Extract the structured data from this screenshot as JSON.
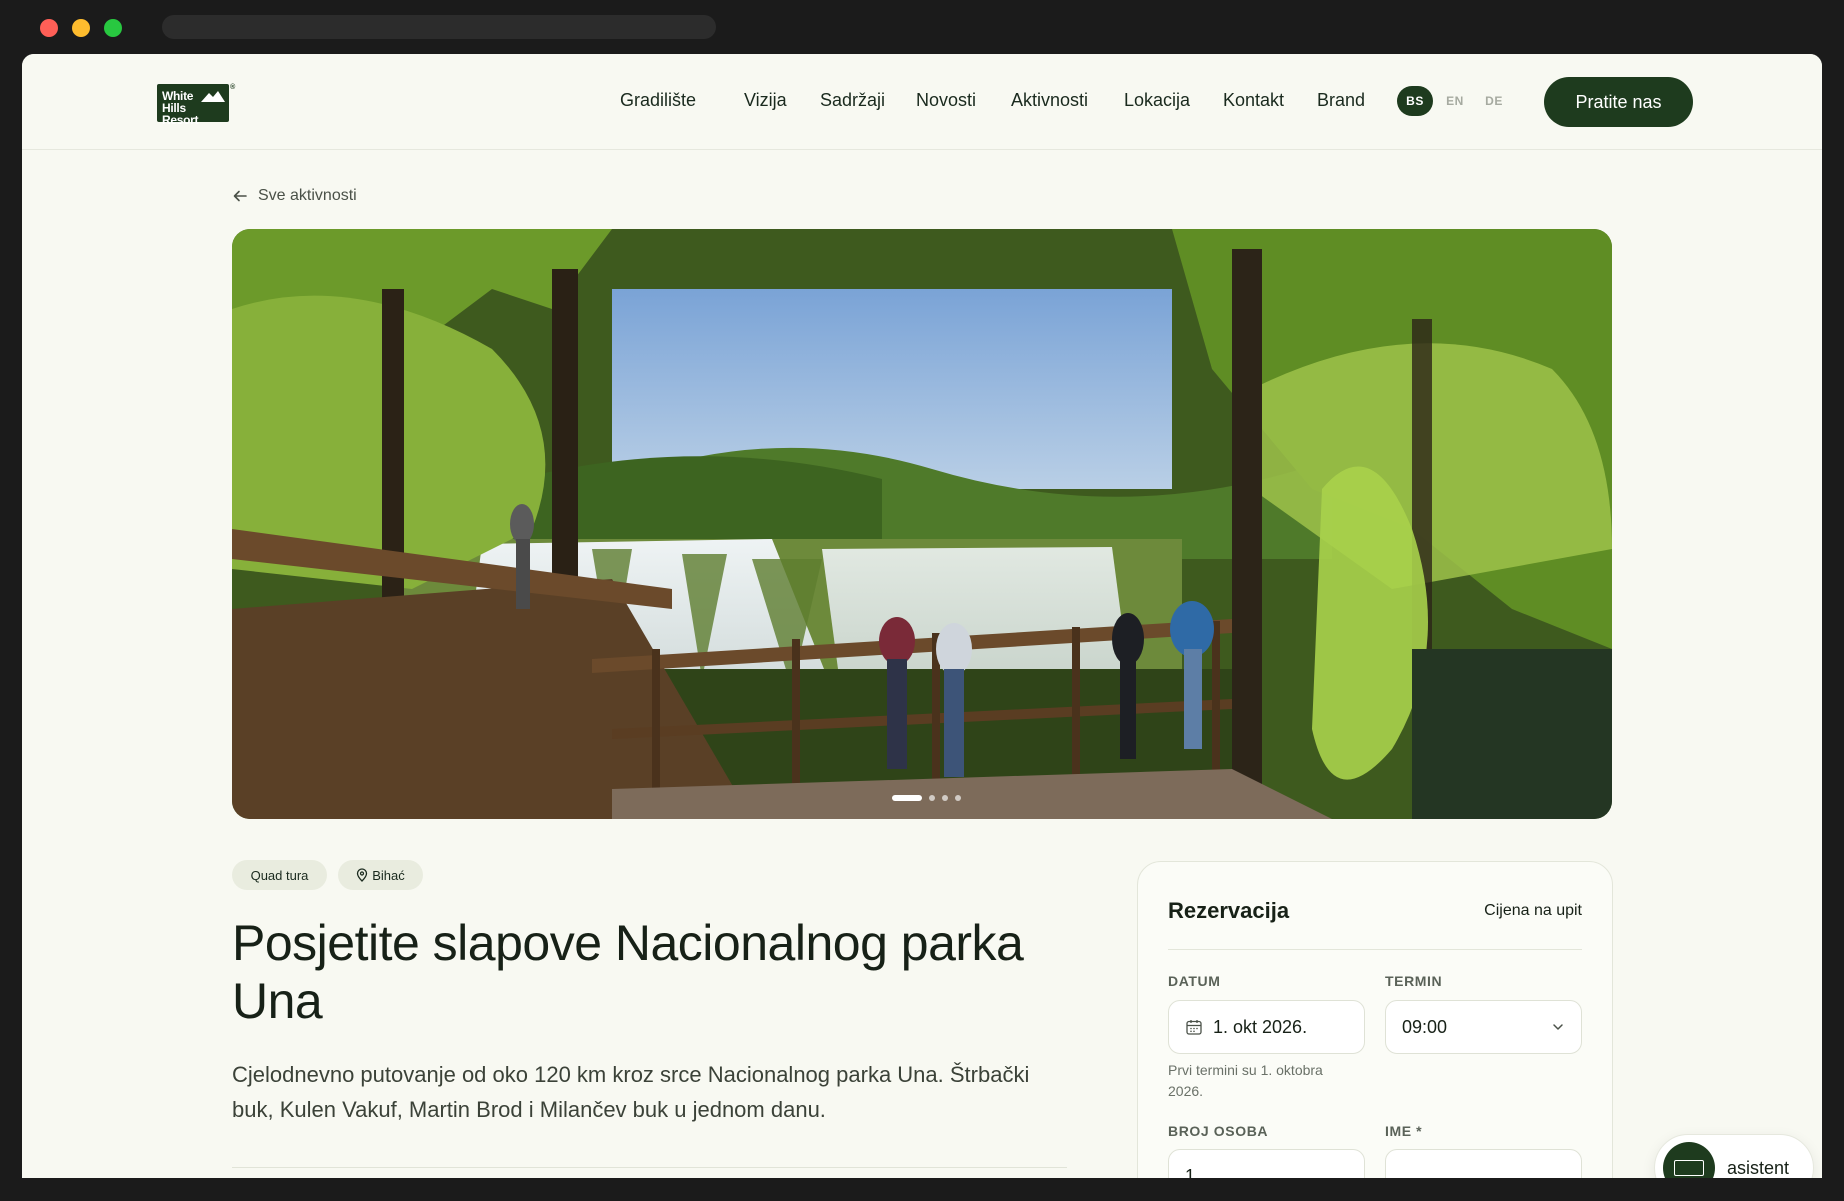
{
  "window": {
    "controls": [
      "close",
      "minimize",
      "maximize"
    ]
  },
  "header": {
    "logo": {
      "line1": "White",
      "line2": "Hills Resort",
      "registered": "®"
    },
    "nav": [
      {
        "label": "Gradilište"
      },
      {
        "label": "Vizija"
      },
      {
        "label": "Sadržaji"
      },
      {
        "label": "Novosti"
      },
      {
        "label": "Aktivnosti"
      },
      {
        "label": "Lokacija"
      },
      {
        "label": "Kontakt"
      },
      {
        "label": "Brand"
      }
    ],
    "languages": {
      "active": "BS",
      "en": "EN",
      "de": "DE"
    },
    "cta": "Pratite nas"
  },
  "back_link": {
    "label": "Sve aktivnosti",
    "icon": "arrow-left-icon"
  },
  "hero": {
    "slides_total": 4,
    "active_slide": 1
  },
  "tags": {
    "category": "Quad tura",
    "location": "Bihać",
    "location_icon": "map-pin-icon"
  },
  "title": "Posjetite slapove Nacionalnog parka Una",
  "description": "Cjelodnevno putovanje od oko 120 km kroz srce Nacionalnog parka Una. Štrbački buk, Kulen Vakuf, Martin Brod i Milančev buk u jednom danu.",
  "booking": {
    "title": "Rezervacija",
    "price": "Cijena na upit",
    "date_label": "DATUM",
    "date_value": "1. okt 2026.",
    "date_icon": "calendar-icon",
    "time_label": "TERMIN",
    "time_value": "09:00",
    "hint": "Prvi termini su 1. oktobra 2026.",
    "people_label": "BROJ OSOBA",
    "people_value": "1",
    "name_label": "IME *",
    "name_value": ""
  },
  "assistant": {
    "label": "asistent"
  },
  "colors": {
    "brand": "#1e3b1e",
    "background": "#f8f9f2",
    "tag": "#e9ecdf"
  }
}
